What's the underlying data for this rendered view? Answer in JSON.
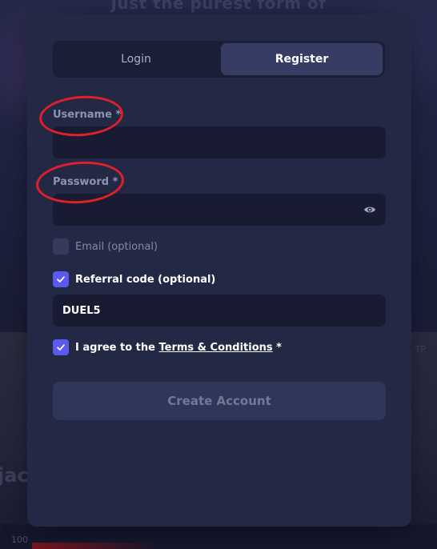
{
  "background": {
    "headline": "Just the purest form of",
    "word": "jac",
    "rtp": "TP",
    "pct": "100"
  },
  "tabs": {
    "login": "Login",
    "register": "Register"
  },
  "form": {
    "username_label": "Username *",
    "username_value": "",
    "password_label": "Password *",
    "password_value": "",
    "email_label": "Email (optional)",
    "email_checked": false,
    "referral_label": "Referral code (optional)",
    "referral_checked": true,
    "referral_value": "DUEL5",
    "terms_prefix": "I agree to the ",
    "terms_link": "Terms & Conditions",
    "terms_suffix": " *",
    "terms_checked": true,
    "submit_label": "Create Account"
  },
  "colors": {
    "accent": "#5a59f0",
    "panel": "#232845",
    "annotation": "#e01f2b"
  },
  "icons": {
    "password_toggle": "eye-icon",
    "checkmark": "check-icon"
  }
}
